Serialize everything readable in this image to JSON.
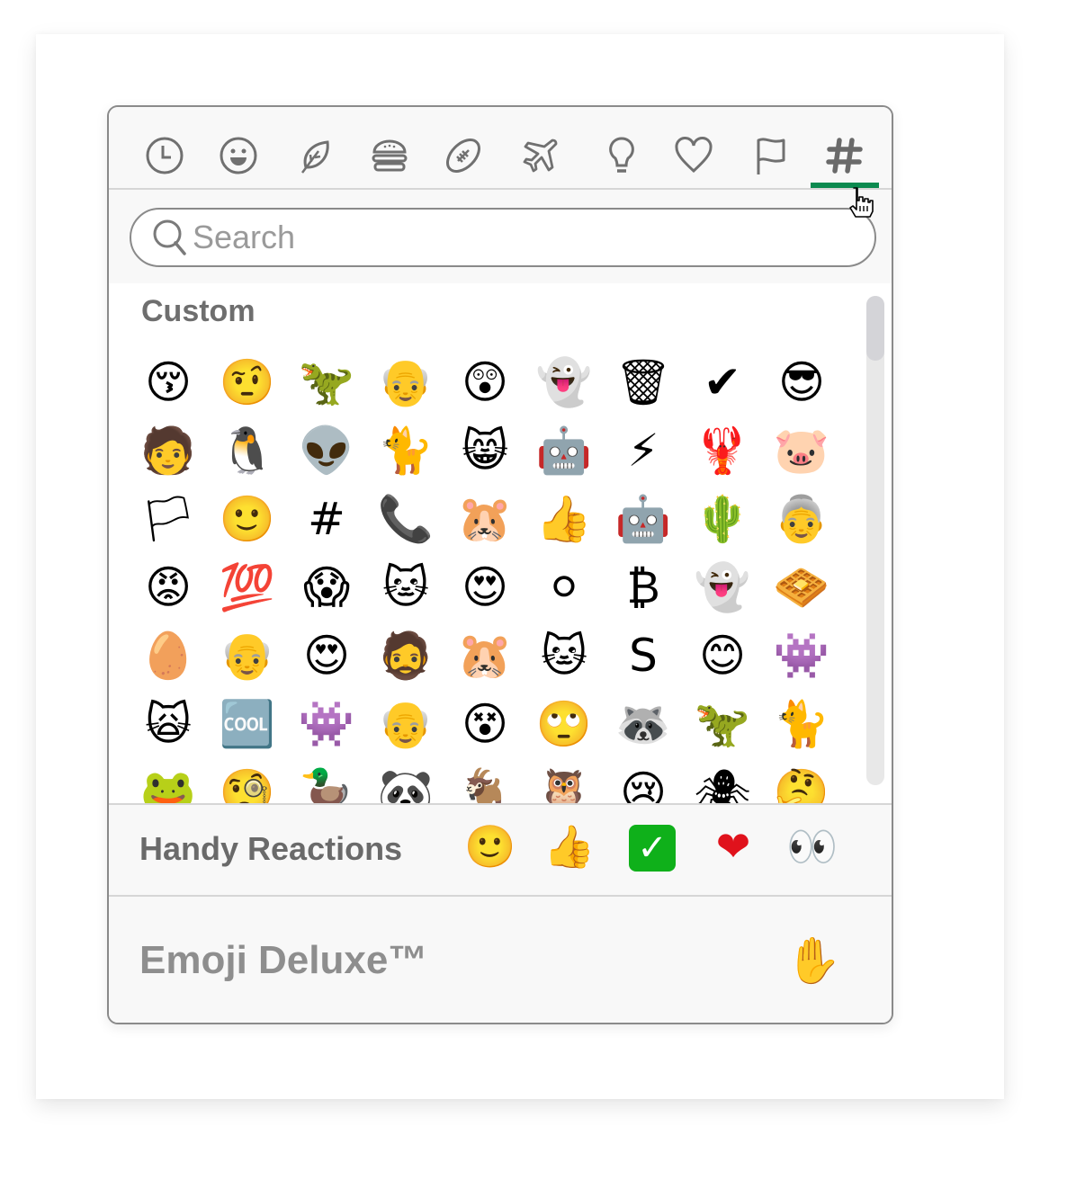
{
  "tabs": [
    {
      "name": "recent",
      "icon": "clock-icon"
    },
    {
      "name": "smileys",
      "icon": "smiley-icon"
    },
    {
      "name": "nature",
      "icon": "leaf-icon"
    },
    {
      "name": "food",
      "icon": "burger-icon"
    },
    {
      "name": "activity",
      "icon": "football-icon"
    },
    {
      "name": "travel",
      "icon": "airplane-icon"
    },
    {
      "name": "objects",
      "icon": "lightbulb-icon"
    },
    {
      "name": "symbols",
      "icon": "heart-icon"
    },
    {
      "name": "flags",
      "icon": "flag-icon"
    },
    {
      "name": "custom",
      "icon": "hash-icon",
      "active": true
    }
  ],
  "accent_color": "#0b8a4f",
  "search": {
    "placeholder": "Search",
    "value": ""
  },
  "section": {
    "title": "Custom"
  },
  "emoji_rows": [
    [
      "😚",
      "🤨",
      "🦖",
      "👴",
      "😲",
      "👻",
      "🗑",
      "✔",
      "😎"
    ],
    [
      "🧑",
      "🐧",
      "👽",
      "🐈",
      "😸",
      "🤖",
      "⚡",
      "🦞",
      "🐷"
    ],
    [
      "🏳",
      "🙂",
      "#",
      "📞",
      "🐹",
      "👍",
      "🤖",
      "🌵",
      "👵"
    ],
    [
      "😡",
      "💯",
      "😱",
      "🐱",
      "😍",
      "⚪",
      "₿",
      "👻",
      "🧇"
    ],
    [
      "🥚",
      "👴",
      "😍",
      "🧔",
      "🐹",
      "🐱",
      "S",
      "😊",
      "👾"
    ],
    [
      "🙀",
      "🆒",
      "👾",
      "👴",
      "😵",
      "🙄",
      "🦝",
      "🦖",
      "🐈"
    ],
    [
      "🐸",
      "🧐",
      "🦆",
      "🐼",
      "🐐",
      "🦉",
      "😢",
      "🕷",
      "🤔"
    ]
  ],
  "scroll": {
    "position": 0.0,
    "visible_fraction": 0.13
  },
  "handy": {
    "label": "Handy Reactions",
    "emojis": [
      "🙂",
      "👍",
      "✓",
      "❤",
      "👀"
    ]
  },
  "deluxe": {
    "label": "Emoji Deluxe™",
    "emoji": "✋"
  }
}
